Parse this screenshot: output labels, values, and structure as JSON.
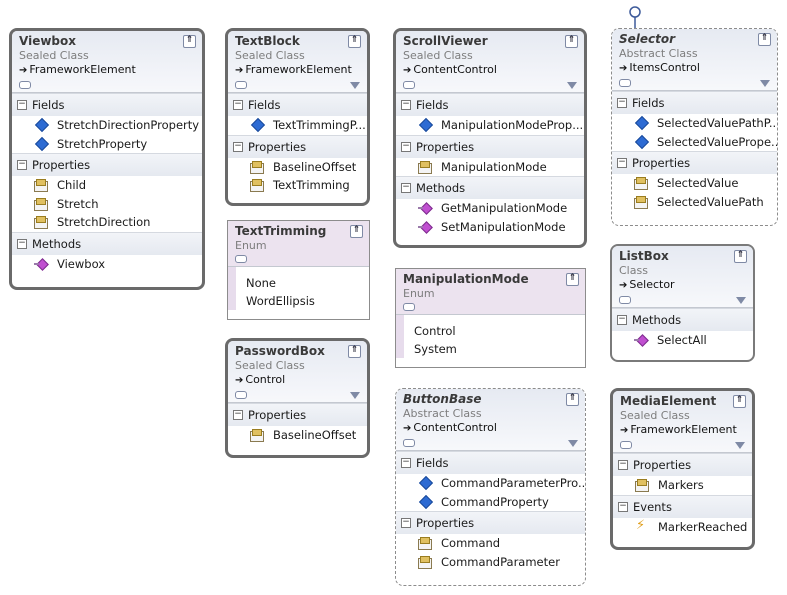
{
  "boxes": {
    "viewbox": {
      "title": "Viewbox",
      "stereotype": "Sealed Class",
      "base": "FrameworkElement",
      "sections": [
        {
          "label": "Fields",
          "members": [
            "StretchDirectionProperty",
            "StretchProperty"
          ]
        },
        {
          "label": "Properties",
          "members": [
            "Child",
            "Stretch",
            "StretchDirection"
          ]
        },
        {
          "label": "Methods",
          "members": [
            "Viewbox"
          ]
        }
      ]
    },
    "textblock": {
      "title": "TextBlock",
      "stereotype": "Sealed Class",
      "base": "FrameworkElement",
      "sections": [
        {
          "label": "Fields",
          "members": [
            "TextTrimmingP..."
          ]
        },
        {
          "label": "Properties",
          "members": [
            "BaselineOffset",
            "TextTrimming"
          ]
        }
      ]
    },
    "texttrimming": {
      "title": "TextTrimming",
      "stereotype": "Enum",
      "values": [
        "None",
        "WordEllipsis"
      ]
    },
    "passwordbox": {
      "title": "PasswordBox",
      "stereotype": "Sealed Class",
      "base": "Control",
      "sections": [
        {
          "label": "Properties",
          "members": [
            "BaselineOffset"
          ]
        }
      ]
    },
    "scrollviewer": {
      "title": "ScrollViewer",
      "stereotype": "Sealed Class",
      "base": "ContentControl",
      "sections": [
        {
          "label": "Fields",
          "members": [
            "ManipulationModeProp..."
          ]
        },
        {
          "label": "Properties",
          "members": [
            "ManipulationMode"
          ]
        },
        {
          "label": "Methods",
          "members": [
            "GetManipulationMode",
            "SetManipulationMode"
          ]
        }
      ]
    },
    "manipulationmode": {
      "title": "ManipulationMode",
      "stereotype": "Enum",
      "values": [
        "Control",
        "System"
      ]
    },
    "buttonbase": {
      "title": "ButtonBase",
      "stereotype": "Abstract Class",
      "base": "ContentControl",
      "sections": [
        {
          "label": "Fields",
          "members": [
            "CommandParameterPro...",
            "CommandProperty"
          ]
        },
        {
          "label": "Properties",
          "members": [
            "Command",
            "CommandParameter"
          ]
        }
      ]
    },
    "selector": {
      "title": "Selector",
      "stereotype": "Abstract Class",
      "base": "ItemsControl",
      "sections": [
        {
          "label": "Fields",
          "members": [
            "SelectedValuePathP...",
            "SelectedValuePrope..."
          ]
        },
        {
          "label": "Properties",
          "members": [
            "SelectedValue",
            "SelectedValuePath"
          ]
        }
      ]
    },
    "listbox": {
      "title": "ListBox",
      "stereotype": "Class",
      "base": "Selector",
      "sections": [
        {
          "label": "Methods",
          "members": [
            "SelectAll"
          ]
        }
      ]
    },
    "mediaelement": {
      "title": "MediaElement",
      "stereotype": "Sealed Class",
      "base": "FrameworkElement",
      "sections": [
        {
          "label": "Properties",
          "members": [
            "Markers"
          ]
        },
        {
          "label": "Events",
          "members": [
            "MarkerReached"
          ]
        }
      ]
    }
  },
  "glyphs": {
    "collapse": "⇑",
    "inherits": "➔",
    "section_expanded": "−"
  }
}
